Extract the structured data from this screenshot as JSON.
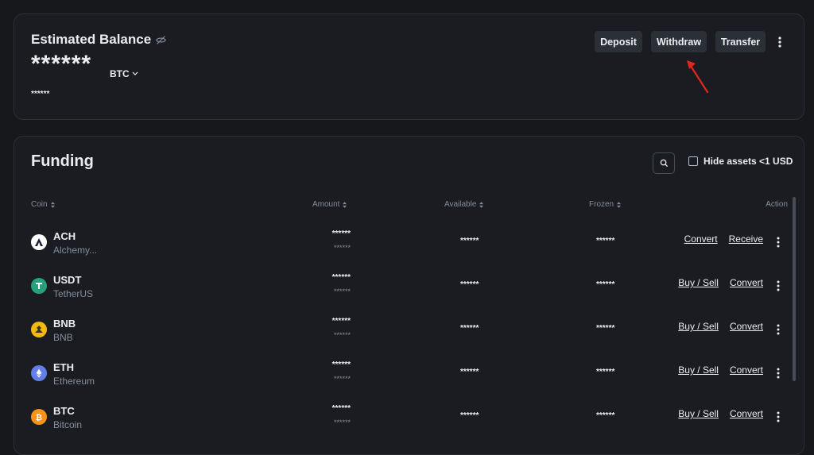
{
  "balance": {
    "title": "Estimated Balance",
    "value": "******",
    "currency": "BTC",
    "sub_value": "******",
    "buttons": {
      "deposit": "Deposit",
      "withdraw": "Withdraw",
      "transfer": "Transfer"
    }
  },
  "funding": {
    "title": "Funding",
    "hide_assets_label": "Hide assets <1 USD",
    "columns": {
      "coin": "Coin",
      "amount": "Amount",
      "available": "Available",
      "frozen": "Frozen",
      "action": "Action"
    },
    "rows": [
      {
        "symbol": "ACH",
        "name": "Alchemy...",
        "amount": "******",
        "amount_sub": "******",
        "available": "******",
        "frozen": "******",
        "action1": "Convert",
        "action2": "Receive",
        "icon": "ach-coin-icon",
        "color": "#ffffff"
      },
      {
        "symbol": "USDT",
        "name": "TetherUS",
        "amount": "******",
        "amount_sub": "******",
        "available": "******",
        "frozen": "******",
        "action1": "Buy / Sell",
        "action2": "Convert",
        "icon": "usdt-coin-icon",
        "color": "#26a17b"
      },
      {
        "symbol": "BNB",
        "name": "BNB",
        "amount": "******",
        "amount_sub": "******",
        "available": "******",
        "frozen": "******",
        "action1": "Buy / Sell",
        "action2": "Convert",
        "icon": "bnb-coin-icon",
        "color": "#f0b90b"
      },
      {
        "symbol": "ETH",
        "name": "Ethereum",
        "amount": "******",
        "amount_sub": "******",
        "available": "******",
        "frozen": "******",
        "action1": "Buy / Sell",
        "action2": "Convert",
        "icon": "eth-coin-icon",
        "color": "#627eea"
      },
      {
        "symbol": "BTC",
        "name": "Bitcoin",
        "amount": "******",
        "amount_sub": "******",
        "available": "******",
        "frozen": "******",
        "action1": "Buy / Sell",
        "action2": "Convert",
        "icon": "btc-coin-icon",
        "color": "#f7931a"
      }
    ]
  },
  "colors": {
    "background": "#17181c",
    "card": "#1b1c21",
    "button": "#2b2f36",
    "annotation_arrow": "#e5261f"
  }
}
